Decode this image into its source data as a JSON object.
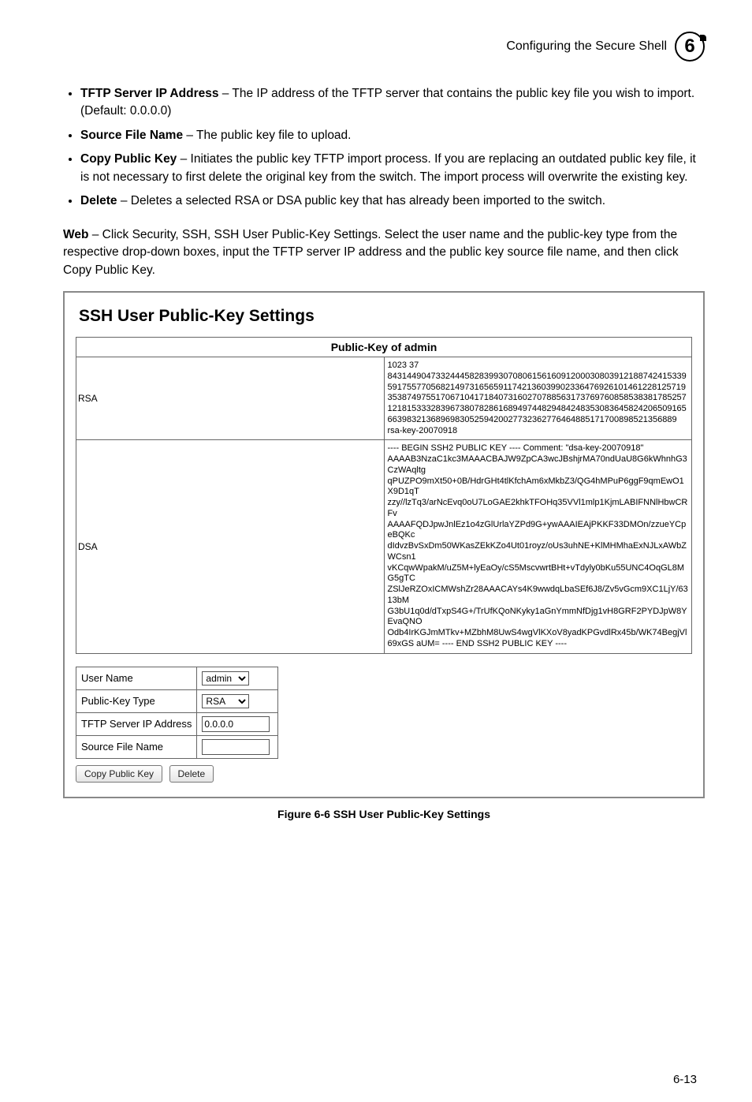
{
  "header": {
    "title": "Configuring the Secure Shell",
    "chapter": "6"
  },
  "bullets": [
    {
      "label": "TFTP Server IP Address",
      "text": " – The IP address of the TFTP server that contains the public key file you wish to import. (Default: 0.0.0.0)"
    },
    {
      "label": "Source File Name",
      "text": " – The public key file to upload."
    },
    {
      "label": "Copy Public Key",
      "text": " – Initiates the public key TFTP import process. If you are replacing an outdated public key file, it is not necessary to first delete the original key from the switch. The import process will overwrite the existing key."
    },
    {
      "label": "Delete",
      "text": " – Deletes a selected RSA or DSA public key that has already been imported to the switch."
    }
  ],
  "web_para": {
    "label": "Web",
    "text": " – Click Security, SSH, SSH User Public-Key Settings. Select the user name and the public-key type from the respective drop-down boxes, input the TFTP server IP address and the public key source file name, and then click Copy Public Key."
  },
  "panel": {
    "heading": "SSH User Public-Key Settings",
    "table_header": "Public-Key of admin",
    "rows": [
      {
        "label": "RSA",
        "content": "1023 37 84314490473324445828399307080615616091200030803912188742415339591755770568214973165659117421360399023364769261014612281257193538749755170671041718407316027078856317376976085853838178525712181533328396738078286168949744829484248353083645824206509165663983213689698305259420027732362776464885171700898521356889 rsa-key-20070918"
      },
      {
        "label": "DSA",
        "content": "---- BEGIN SSH2 PUBLIC KEY ---- Comment: \"dsa-key-20070918\" AAAAB3NzaC1kc3MAAACBAJW9ZpCA3wcJBshjrMA70ndUaU8G6kWhnhG3CzWAqltg qPUZPO9mXt50+0B/HdrGHt4tlKfchAm6xMkbZ3/QG4hMPuP6ggF9qmEwO1X9D1qT zzy//lzTq3/arNcEvq0oU7LoGAE2khkTFOHq35VVl1mlp1KjmLABIFNNlHbwCRFv AAAAFQDJpwJnlEz1o4zGlUrlaYZPd9G+ywAAAIEAjPKKF33DMOn/zzueYCpeBQKc dIdvzBvSxDm50WKasZEkKZo4Ut01royz/oUs3uhNE+KlMHMhaExNJLxAWbZWCsn1 vKCqwWpakM/uZ5M+lyEaOy/cS5MscvwrtBHt+vTdyly0bKu55UNC4OqGL8MG5gTC ZSlJeRZOxICMWshZr28AAACAYs4K9wwdqLbaSEf6J8/Zv5vGcm9XC1LjY/6313bM G3bU1q0d/dTxpS4G+/TrUfKQoNKyky1aGnYmmNfDjg1vH8GRF2PYDJpW8YEvaQNO Odb4IrKGJmMTkv+MZbhM8UwS4wgVlKXoV8yadKPGvdlRx45b/WK74BegjVl69xGS aUM= ---- END SSH2 PUBLIC KEY ----"
      }
    ],
    "form": {
      "user_name": {
        "label": "User Name",
        "value": "admin"
      },
      "pk_type": {
        "label": "Public-Key Type",
        "value": "RSA"
      },
      "tftp_ip": {
        "label": "TFTP Server IP Address",
        "value": "0.0.0.0"
      },
      "src_file": {
        "label": "Source File Name",
        "value": ""
      }
    },
    "buttons": {
      "copy": "Copy Public Key",
      "delete": "Delete"
    }
  },
  "figure_caption": "Figure 6-6   SSH User Public-Key Settings",
  "page_number": "6-13"
}
